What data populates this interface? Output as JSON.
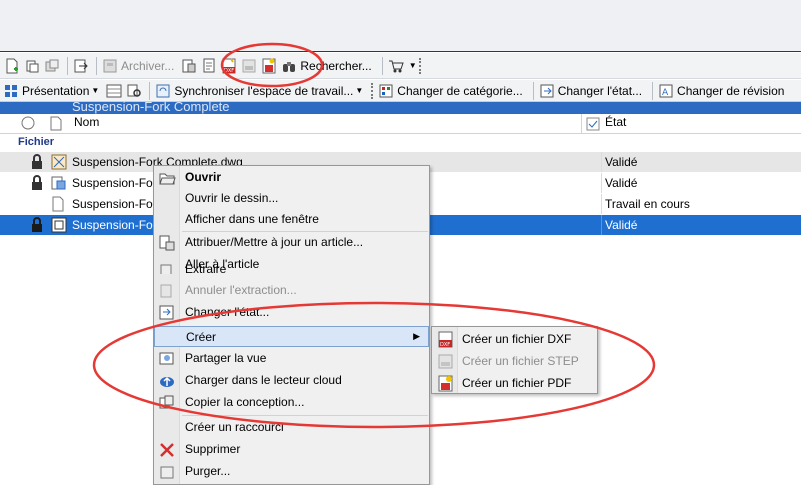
{
  "toolbar1": {
    "archive_label": "Archiver...",
    "search_label": "Rechercher..."
  },
  "toolbar2": {
    "presentation_label": "Présentation",
    "sync_label": "Synchroniser l'espace de travail...",
    "change_category_label": "Changer de catégorie...",
    "change_state_label": "Changer l'état...",
    "change_revision_label": "Changer de révision"
  },
  "panel": {
    "title_partial": "Suspension-Fork Complete"
  },
  "columns": {
    "name": "Nom",
    "state": "État"
  },
  "group_label": "Fichier",
  "rows": [
    {
      "name": "Suspension-Fork Complete.dwg",
      "state": "Validé"
    },
    {
      "name": "Suspension-Fork",
      "state": "Validé"
    },
    {
      "name": "Suspension-Fork",
      "state": "Travail en cours"
    },
    {
      "name": "Suspension-Fork",
      "state": "Validé"
    }
  ],
  "context_menu": {
    "items": [
      {
        "label": "Ouvrir"
      },
      {
        "label": "Ouvrir le dessin..."
      },
      {
        "label": "Afficher dans une fenêtre"
      },
      {
        "label": "Attribuer/Mettre à jour un article..."
      },
      {
        "label": "Aller à l'article"
      },
      {
        "label": "Extraire"
      },
      {
        "label": "Annuler l'extraction..."
      },
      {
        "label": "Changer l'état..."
      },
      {
        "label": "Créer"
      },
      {
        "label": "Partager la vue"
      },
      {
        "label": "Charger dans le lecteur cloud"
      },
      {
        "label": "Copier la conception..."
      },
      {
        "label": "Créer un raccourci"
      },
      {
        "label": "Supprimer"
      },
      {
        "label": "Purger..."
      }
    ]
  },
  "submenu": {
    "items": [
      {
        "label": "Créer un fichier DXF"
      },
      {
        "label": "Créer un fichier STEP"
      },
      {
        "label": "Créer un fichier PDF"
      }
    ]
  },
  "colors": {
    "selection": "#1f6fd0",
    "annotation": "#e53935",
    "panel_header": "#2d6bc2"
  }
}
